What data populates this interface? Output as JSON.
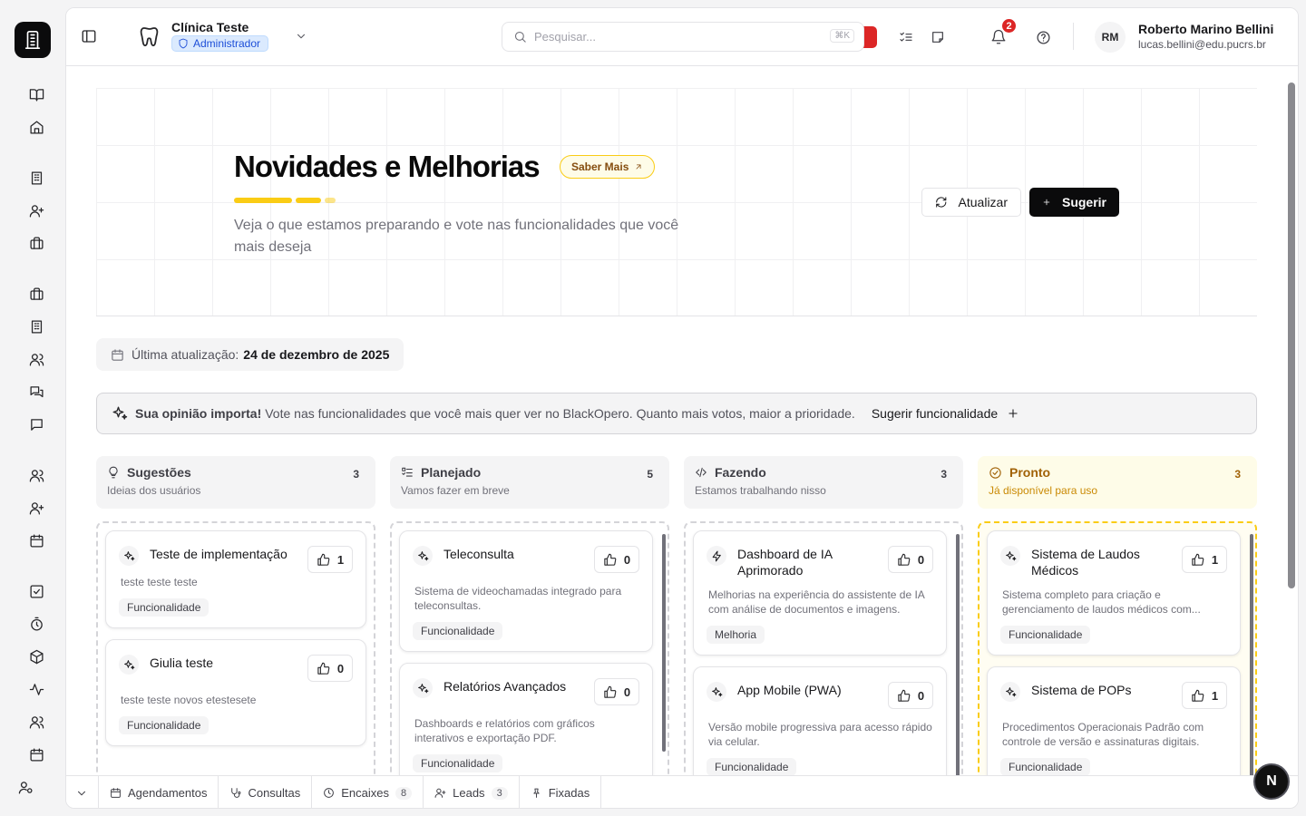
{
  "header": {
    "clinic_name": "Clínica Teste",
    "role": "Administrador",
    "search_placeholder": "Pesquisar...",
    "search_shortcut": "⌘K",
    "notification_count": "2",
    "user_initials": "RM",
    "user_name": "Roberto Marino Bellini",
    "user_email": "lucas.bellini@edu.pucrs.br"
  },
  "hero": {
    "title": "Novidades e Melhorias",
    "learn_more": "Saber Mais",
    "subtitle": "Veja o que estamos preparando e vote nas funcionalidades que você mais deseja",
    "refresh_label": "Atualizar",
    "suggest_label": "Sugerir"
  },
  "last_update": {
    "label": "Última atualização:",
    "date": "24 de dezembro de 2025"
  },
  "banner": {
    "strong": "Sua opinião importa!",
    "text": "Vote nas funcionalidades que você mais quer ver no BlackOpero. Quanto mais votos, maior a prioridade.",
    "cta": "Sugerir funcionalidade"
  },
  "columns": [
    {
      "title": "Sugestões",
      "subtitle": "Ideias dos usuários",
      "count": "3",
      "cards": [
        {
          "title": "Teste de implementação",
          "desc": "teste teste teste",
          "tag": "Funcionalidade",
          "votes": "1"
        },
        {
          "title": "Giulia teste",
          "desc": "teste teste novos etestesete",
          "tag": "Funcionalidade",
          "votes": "0"
        }
      ]
    },
    {
      "title": "Planejado",
      "subtitle": "Vamos fazer em breve",
      "count": "5",
      "cards": [
        {
          "title": "Teleconsulta",
          "desc": "Sistema de videochamadas integrado para teleconsultas.",
          "tag": "Funcionalidade",
          "votes": "0"
        },
        {
          "title": "Relatórios Avançados",
          "desc": "Dashboards e relatórios com gráficos interativos e exportação PDF.",
          "tag": "Funcionalidade",
          "votes": "0"
        }
      ]
    },
    {
      "title": "Fazendo",
      "subtitle": "Estamos trabalhando nisso",
      "count": "3",
      "cards": [
        {
          "title": "Dashboard de IA Aprimorado",
          "desc": "Melhorias na experiência do assistente de IA com análise de documentos e imagens.",
          "tag": "Melhoria",
          "votes": "0"
        },
        {
          "title": "App Mobile (PWA)",
          "desc": "Versão mobile progressiva para acesso rápido via celular.",
          "tag": "Funcionalidade",
          "votes": "0"
        }
      ]
    },
    {
      "title": "Pronto",
      "subtitle": "Já disponível para uso",
      "count": "3",
      "cards": [
        {
          "title": "Sistema de Laudos Médicos",
          "desc": "Sistema completo para criação e gerenciamento de laudos médicos com...",
          "tag": "Funcionalidade",
          "votes": "1"
        },
        {
          "title": "Sistema de POPs",
          "desc": "Procedimentos Operacionais Padrão com controle de versão e assinaturas digitais.",
          "tag": "Funcionalidade",
          "votes": "1"
        }
      ]
    }
  ],
  "bottom_tabs": [
    {
      "label": "Agendamentos",
      "count": ""
    },
    {
      "label": "Consultas",
      "count": ""
    },
    {
      "label": "Encaixes",
      "count": "8"
    },
    {
      "label": "Leads",
      "count": "3"
    },
    {
      "label": "Fixadas",
      "count": ""
    }
  ],
  "floating_badge": "N",
  "colors": {
    "accent_yellow": "#facc15",
    "dark": "#0b0b0c",
    "notification_red": "#dc2626"
  }
}
